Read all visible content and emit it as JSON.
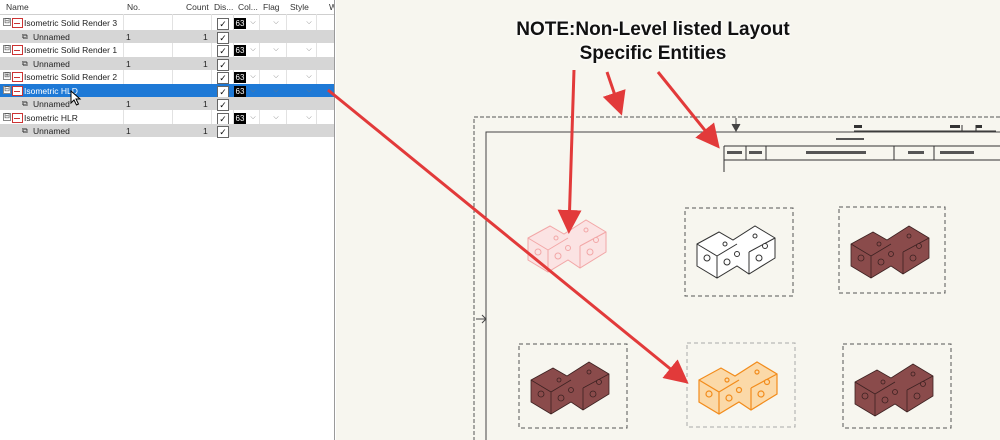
{
  "levels_table": {
    "columns": [
      "Name",
      "No.",
      "Count",
      "Dis...",
      "Col...",
      "Flag",
      "Style",
      "W"
    ],
    "rows": [
      {
        "type": "level",
        "name": "Isometric Solid Render 3",
        "no": "",
        "count": "",
        "color": "63",
        "expander": "⊟"
      },
      {
        "type": "entity",
        "name": "Unnamed",
        "no": "1",
        "count": "1",
        "color": "",
        "expander": ""
      },
      {
        "type": "level",
        "name": "Isometric Solid Render 1",
        "no": "",
        "count": "",
        "color": "63",
        "expander": "⊟"
      },
      {
        "type": "entity",
        "name": "Unnamed",
        "no": "1",
        "count": "1",
        "color": "",
        "expander": ""
      },
      {
        "type": "level",
        "name": "Isometric Solid Render 2",
        "no": "",
        "count": "",
        "color": "63",
        "expander": "⊞"
      },
      {
        "type": "level",
        "name": "Isometric HLD",
        "no": "",
        "count": "",
        "color": "63",
        "expander": "⊟",
        "selected": true
      },
      {
        "type": "entity",
        "name": "Unnamed",
        "no": "1",
        "count": "1",
        "color": "",
        "expander": ""
      },
      {
        "type": "level",
        "name": "Isometric HLR",
        "no": "",
        "count": "",
        "color": "63",
        "expander": "⊟"
      },
      {
        "type": "entity",
        "name": "Unnamed",
        "no": "1",
        "count": "1",
        "color": "",
        "expander": ""
      }
    ]
  },
  "annotation": {
    "line1": "NOTE:Non-Level listed Layout",
    "line2": "Specific Entities",
    "arrow_color": "#e23a3a"
  },
  "colors": {
    "selection": "#1e79d6",
    "row_grey": "#d6d6d6",
    "render_model": "#8a4b4b",
    "hld_model": "#f28c1c",
    "faded_model": "#f2a7a7"
  }
}
